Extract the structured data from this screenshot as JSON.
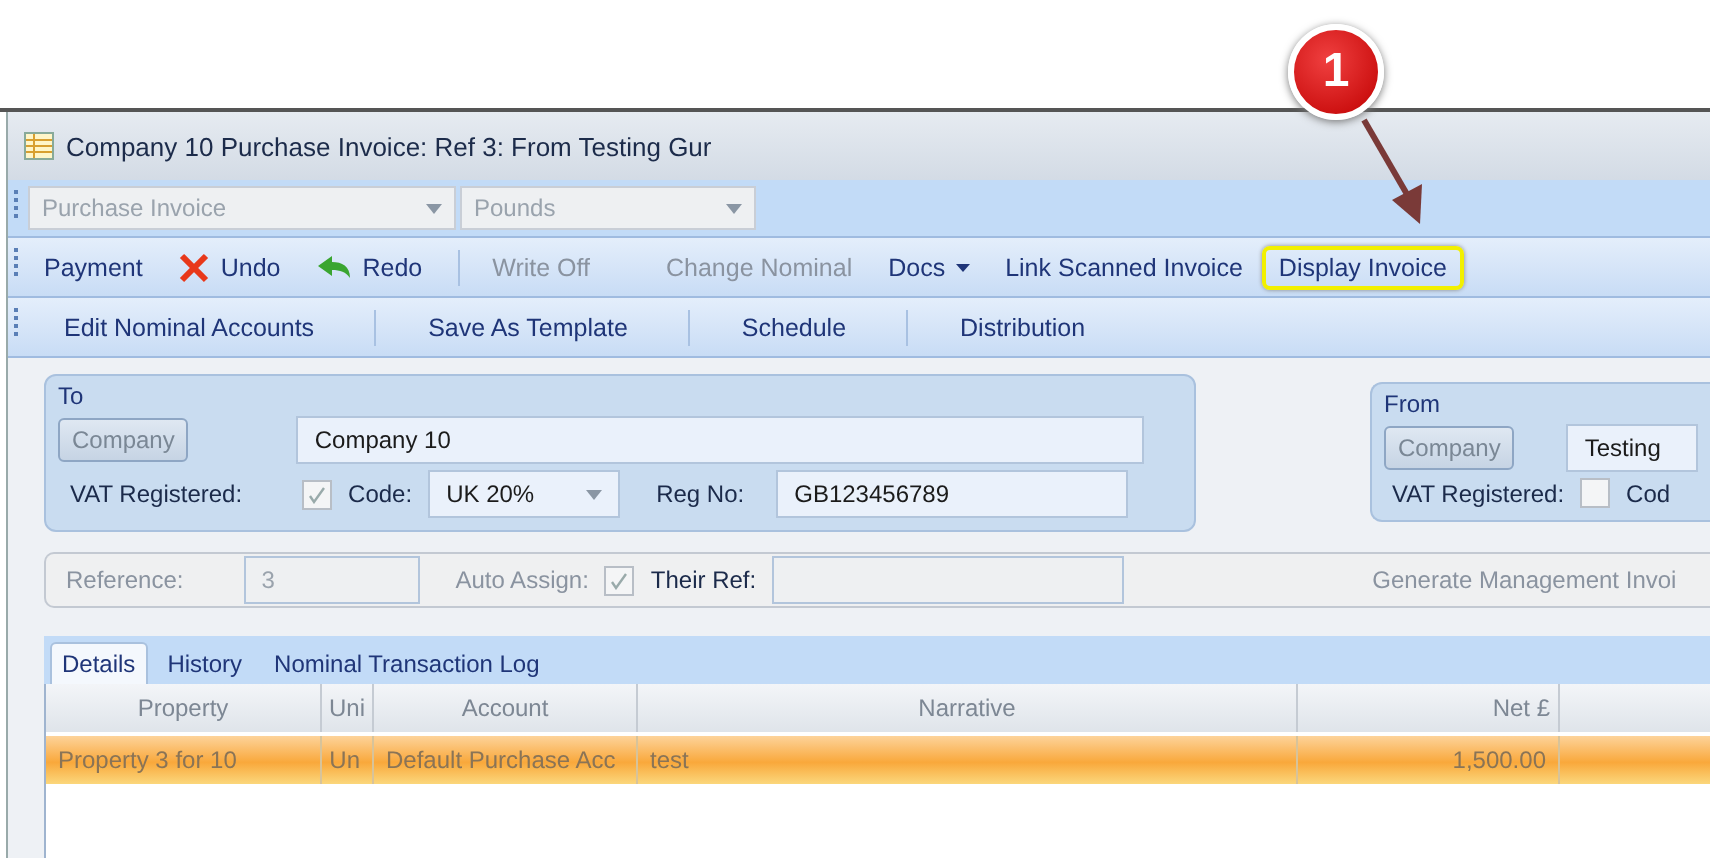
{
  "callout": {
    "number": "1"
  },
  "window": {
    "title": "Company 10 Purchase Invoice: Ref 3: From Testing Gur"
  },
  "selectors": [
    {
      "value": "Purchase Invoice"
    },
    {
      "value": "Pounds"
    }
  ],
  "toolbar": [
    {
      "label": "Payment",
      "kind": "plain",
      "disabled": false,
      "highlighted": false,
      "separator_before": false
    },
    {
      "label": "Undo",
      "kind": "cross",
      "disabled": false,
      "highlighted": false,
      "separator_before": false
    },
    {
      "label": "Redo",
      "kind": "arrow",
      "disabled": false,
      "highlighted": false,
      "separator_before": false
    },
    {
      "label": "Write Off",
      "kind": "plain",
      "disabled": true,
      "highlighted": false,
      "separator_before": true
    },
    {
      "label": "Change Nominal",
      "kind": "plain",
      "disabled": true,
      "highlighted": false,
      "separator_before": false
    },
    {
      "label": "Docs",
      "kind": "menu",
      "disabled": false,
      "highlighted": false,
      "separator_before": false
    },
    {
      "label": "Link Scanned Invoice",
      "kind": "plain",
      "disabled": false,
      "highlighted": false,
      "separator_before": false
    },
    {
      "label": "Display Invoice",
      "kind": "plain",
      "disabled": false,
      "highlighted": true,
      "separator_before": false
    }
  ],
  "toolbar_2": [
    {
      "label": "Edit Nominal Accounts",
      "separator_before": false
    },
    {
      "label": "Save As Template",
      "separator_before": true
    },
    {
      "label": "Schedule",
      "separator_before": true
    },
    {
      "label": "Distribution",
      "separator_before": true
    }
  ],
  "to_panel": {
    "title": "To",
    "company_button": "Company",
    "name": "Company 10",
    "vat_label": "VAT Registered:",
    "vat_checked": true,
    "code_label": "Code:",
    "code": "UK 20%",
    "reg_label": "Reg No:",
    "reg_no": "GB123456789"
  },
  "from_panel": {
    "title": "From",
    "company_button": "Company",
    "name": "Testing",
    "vat_label": "VAT Registered:",
    "vat_checked": false,
    "code_label": "Cod"
  },
  "reference_row": {
    "reference_label": "Reference:",
    "reference": "3",
    "auto_assign_label": "Auto Assign:",
    "auto_assign_checked": true,
    "their_ref_label": "Their Ref:",
    "generate_label": "Generate Management Invoi"
  },
  "tabs": [
    {
      "label": "Details",
      "selected": true
    },
    {
      "label": "History",
      "selected": false
    },
    {
      "label": "Nominal Transaction Log",
      "selected": false
    }
  ],
  "table": {
    "columns": [
      "Property",
      "Uni",
      "Account",
      "Narrative",
      "Net £"
    ],
    "rows": [
      {
        "cells": [
          "Property 3 for 10",
          "Un",
          "Default Purchase Acc",
          "test",
          "1,500.00"
        ],
        "selected": true
      }
    ]
  }
}
